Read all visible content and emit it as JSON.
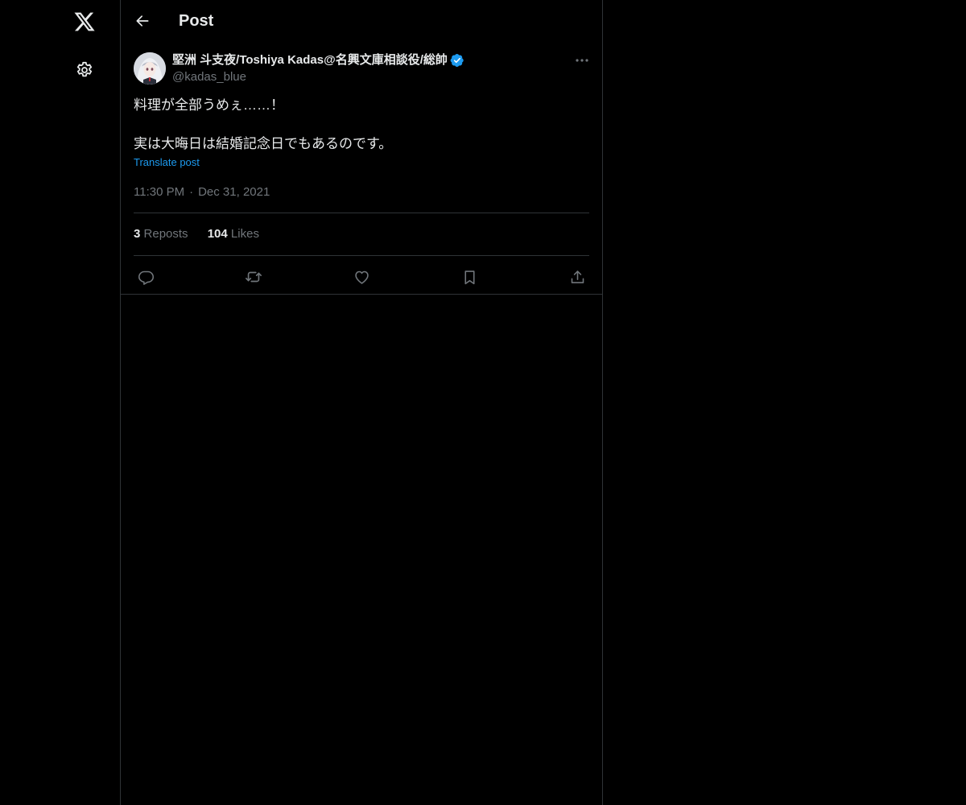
{
  "header": {
    "title": "Post"
  },
  "post": {
    "author_name": "堅洲 斗支夜/Toshiya Kadas@名興文庫相談役/総帥",
    "author_handle": "@kadas_blue",
    "text_line_1": "料理が全部うめぇ……！",
    "text_line_2": "",
    "text_line_3": "実は大晦日は結婚記念日でもあるのです。",
    "translate_label": "Translate post",
    "time": "11:30 PM",
    "separator": "·",
    "date": "Dec 31, 2021",
    "reposts_count": "3",
    "reposts_label": "Reposts",
    "likes_count": "104",
    "likes_label": "Likes"
  },
  "icons": {
    "logo": "x-logo-icon",
    "settings": "gear-icon",
    "back": "arrow-left-icon",
    "more": "more-horizontal-icon",
    "verified": "verified-badge-icon",
    "reply": "reply-icon",
    "repost": "repost-icon",
    "like": "heart-icon",
    "bookmark": "bookmark-icon",
    "share": "share-icon"
  },
  "colors": {
    "background": "#000000",
    "text_primary": "#e7e9ea",
    "text_secondary": "#71767b",
    "accent": "#1d9bf0",
    "border": "#2f3336"
  }
}
